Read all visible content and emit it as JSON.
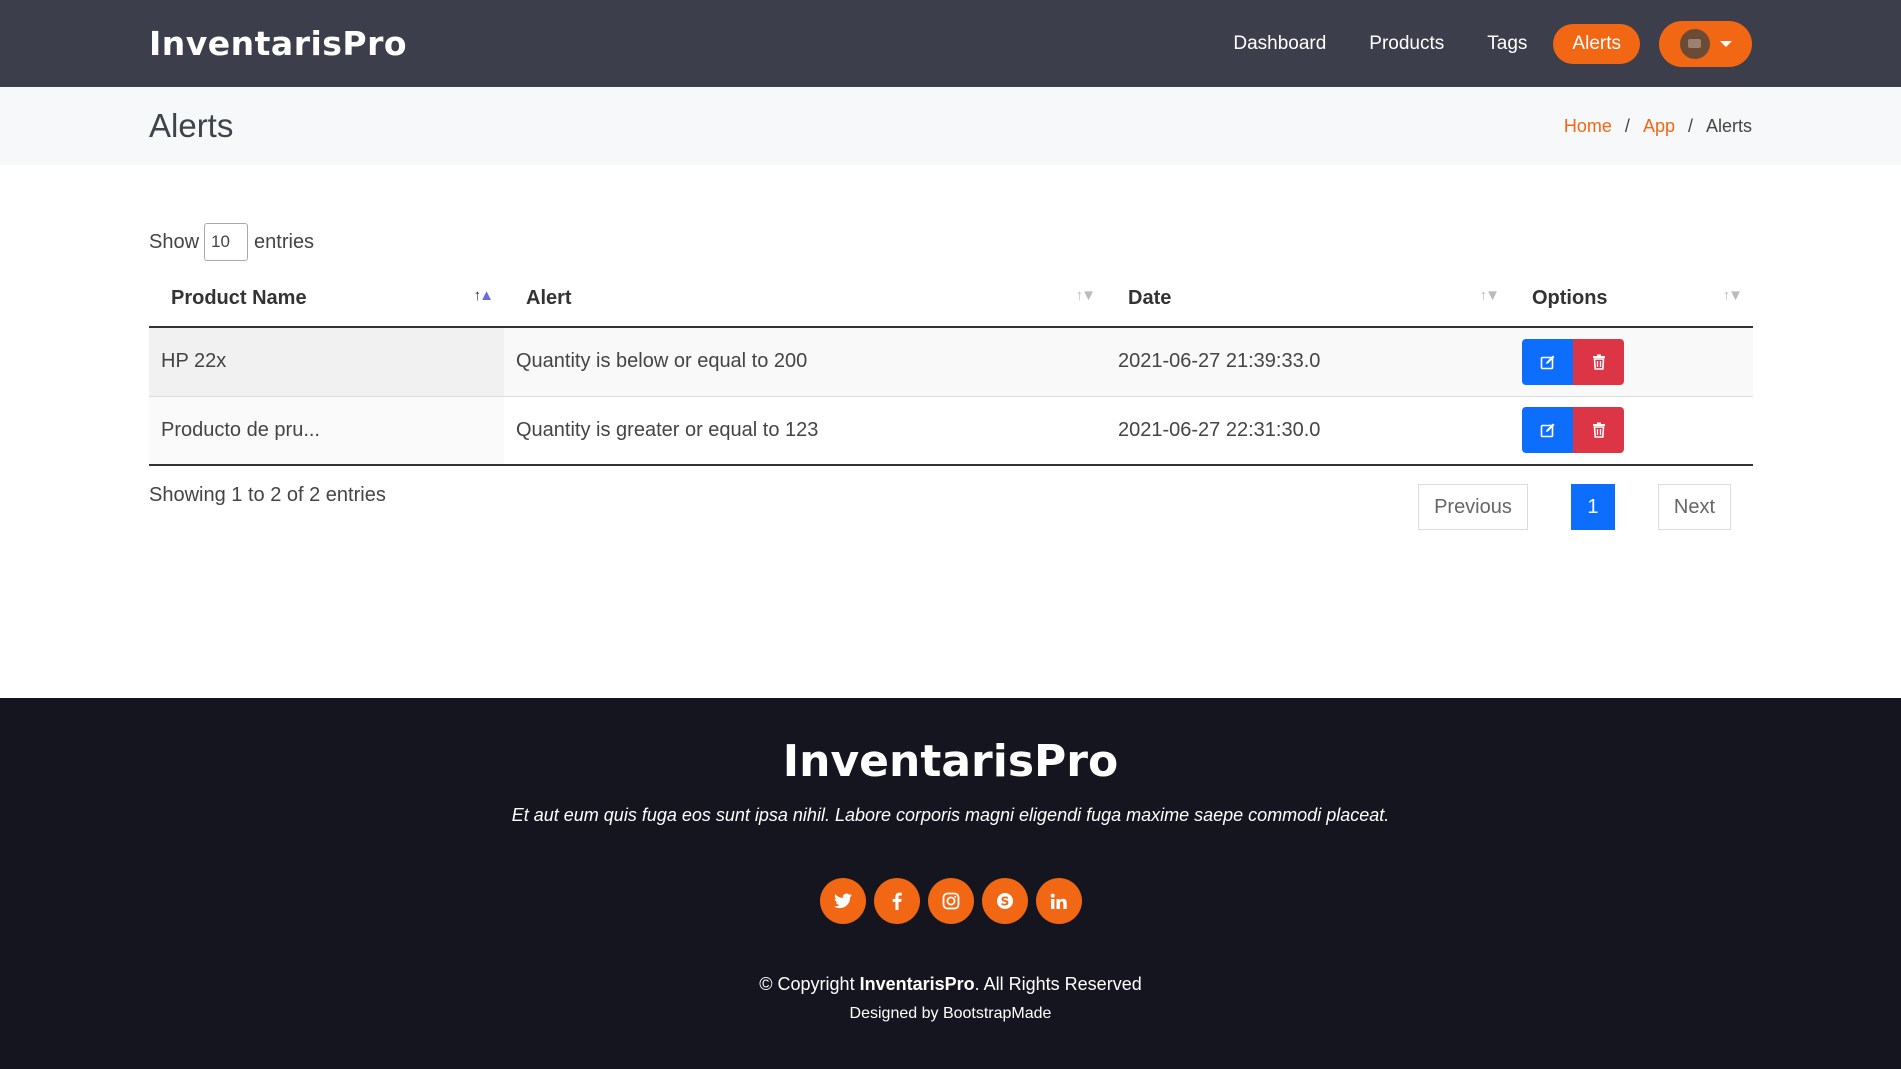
{
  "header": {
    "logo": "InventarisPro",
    "nav": [
      "Dashboard",
      "Products",
      "Tags",
      "Alerts"
    ],
    "active_nav": "Alerts"
  },
  "page": {
    "title": "Alerts",
    "breadcrumb": [
      "Home",
      "App",
      "Alerts"
    ]
  },
  "table": {
    "length_label_before": "Show",
    "length_value": "10",
    "length_label_after": "entries",
    "columns": [
      "Product Name",
      "Alert",
      "Date",
      "Options"
    ],
    "rows": [
      [
        "HP 22x",
        "Quantity is below or equal to 200",
        "2021-06-27 21:39:33.0"
      ],
      [
        "Producto de pru...",
        "Quantity is greater or equal to 123",
        "2021-06-27 22:31:30.0"
      ]
    ],
    "info": "Showing 1 to 2 of 2 entries",
    "pagination": {
      "previous": "Previous",
      "current_page": "1",
      "next": "Next"
    }
  },
  "footer": {
    "logo": "InventarisPro",
    "tagline": "Et aut eum quis fuga eos sunt ipsa nihil. Labore corporis magni eligendi fuga maxime saepe commodi placeat.",
    "social": [
      "twitter-icon",
      "facebook-icon",
      "instagram-icon",
      "skype-icon",
      "linkedin-icon"
    ],
    "copyright_prefix": "© Copyright",
    "copyright_brand": "InventarisPro",
    "copyright_suffix": ". All Rights Reserved",
    "credits": "Designed by BootstrapMade"
  },
  "colors": {
    "accent": "#f16714",
    "header_bg": "#3c3f4b",
    "footer_bg": "#151520",
    "edit_button": "#0d6efd",
    "delete_button": "#dc3545"
  }
}
